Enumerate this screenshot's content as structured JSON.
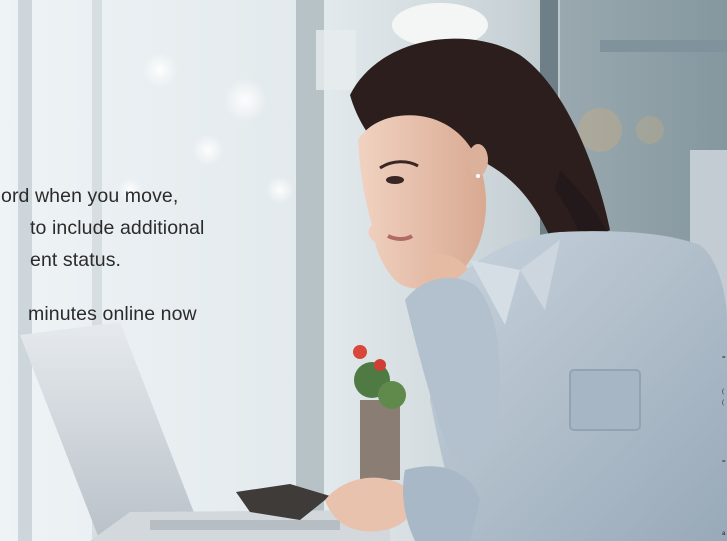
{
  "copy": {
    "line1": "ord when you move,",
    "line2": "to include additional",
    "line3": "ent status.",
    "line4": "minutes online now"
  },
  "edge_fragments": [
    "=",
    "(",
    "(",
    "=",
    "a"
  ],
  "colors": {
    "text": "#2b2b2b",
    "window_light": "#e9f0f3",
    "shirt": "#b9c6d2",
    "hair": "#2c1e1c",
    "skin": "#e8c2ad"
  }
}
